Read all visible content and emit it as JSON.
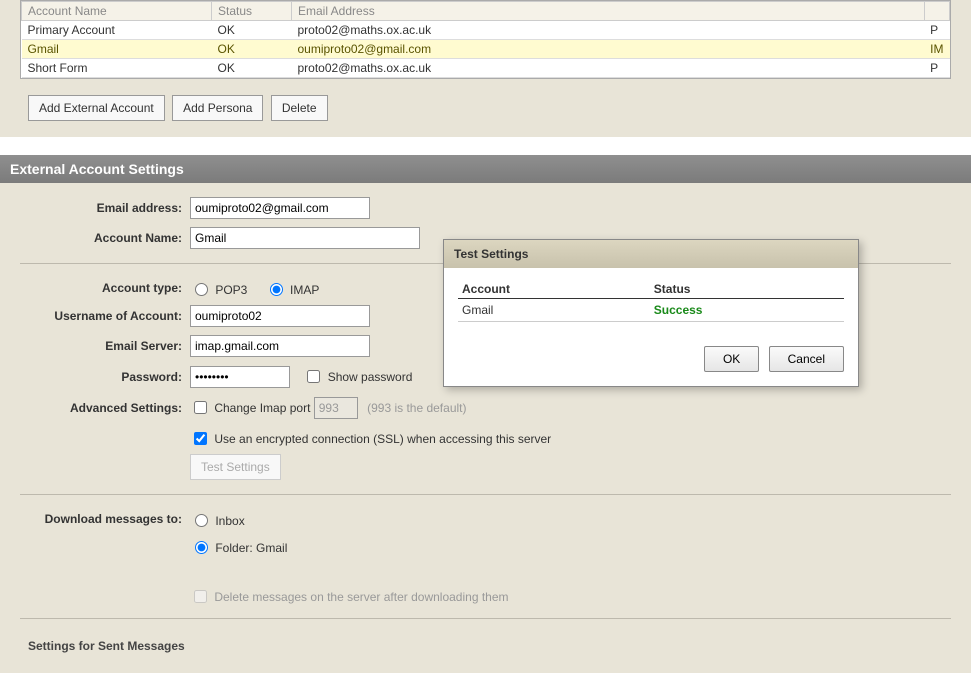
{
  "accounts_table": {
    "headers": [
      "Account Name",
      "Status",
      "Email Address",
      ""
    ],
    "rows": [
      {
        "name": "Primary Account",
        "status": "OK",
        "email": "proto02@maths.ox.ac.uk",
        "rightcol": "P",
        "selected": false
      },
      {
        "name": "Gmail",
        "status": "OK",
        "email": "oumiproto02@gmail.com",
        "rightcol": "IM",
        "selected": true
      },
      {
        "name": "Short Form",
        "status": "OK",
        "email": "proto02@maths.ox.ac.uk",
        "rightcol": "P",
        "selected": false
      }
    ]
  },
  "buttons": {
    "add_external": "Add External Account",
    "add_persona": "Add Persona",
    "delete": "Delete"
  },
  "panel_title": "External Account Settings",
  "labels": {
    "email": "Email address:",
    "account_name": "Account Name:",
    "account_type": "Account type:",
    "username": "Username of Account:",
    "email_server": "Email Server:",
    "password": "Password:",
    "advanced": "Advanced Settings:",
    "download_to": "Download messages to:",
    "sent_settings": "Settings for Sent Messages"
  },
  "values": {
    "email": "oumiproto02@gmail.com",
    "account_name": "Gmail",
    "username": "oumiproto02",
    "email_server": "imap.gmail.com",
    "password": "••••••••",
    "imap_port": "993"
  },
  "options": {
    "pop3": "POP3",
    "imap": "IMAP",
    "show_password": "Show password",
    "change_imap_port": "Change Imap port",
    "port_hint": "(993 is the default)",
    "use_ssl": "Use an encrypted connection (SSL) when accessing this server",
    "test_settings": "Test Settings",
    "inbox": "Inbox",
    "folder_gmail": "Folder: Gmail",
    "delete_after": "Delete messages on the server after downloading them"
  },
  "dialog": {
    "title": "Test Settings",
    "col_account": "Account",
    "col_status": "Status",
    "row_account": "Gmail",
    "row_status": "Success",
    "ok": "OK",
    "cancel": "Cancel"
  }
}
